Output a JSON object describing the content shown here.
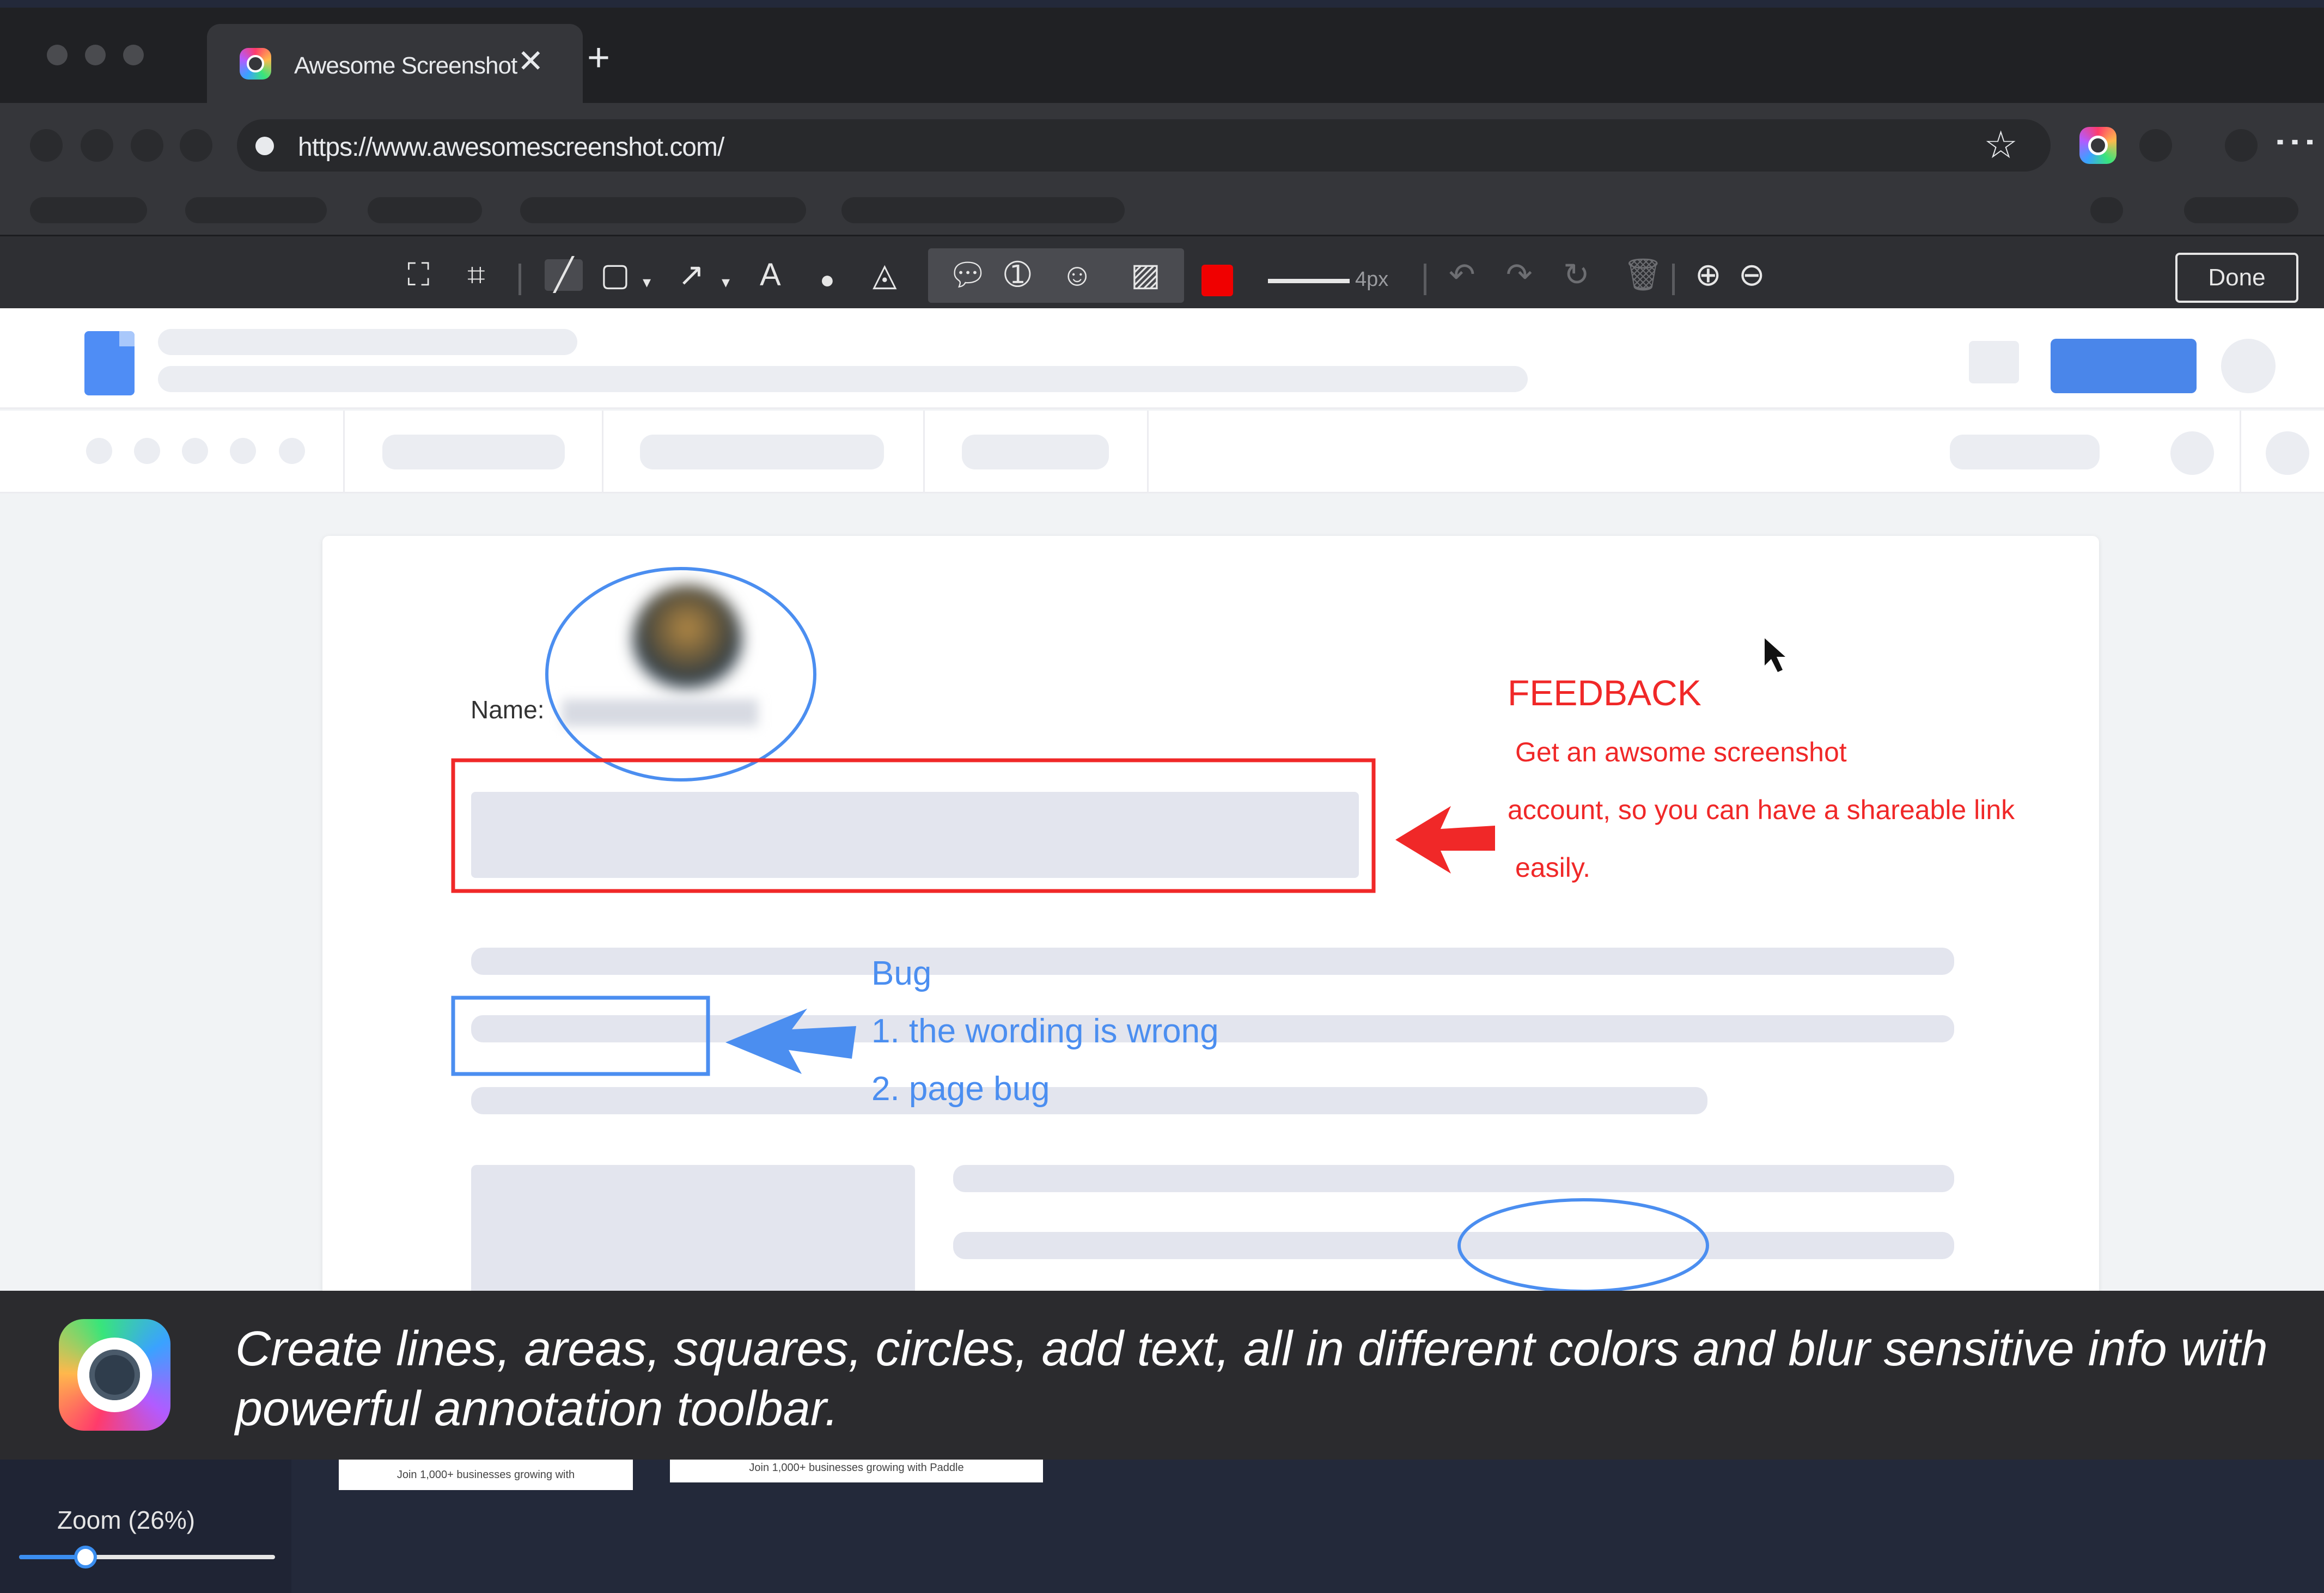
{
  "browser": {
    "tab_title": "Awesome Screenshot",
    "tab_close": "✕",
    "new_tab": "+",
    "url": "https://www.awesomescreenshot.com/",
    "star": "☆",
    "menu": "⋮"
  },
  "toolbar": {
    "tools": [
      {
        "name": "full-page-icon",
        "glyph": "⛶"
      },
      {
        "name": "crop-icon",
        "glyph": "⌗"
      },
      {
        "name": "line-tool-icon",
        "glyph": "╱"
      },
      {
        "name": "rectangle-tool-icon",
        "glyph": "▢"
      },
      {
        "name": "arrow-tool-icon",
        "glyph": "↗"
      },
      {
        "name": "text-tool-icon",
        "glyph": "A"
      },
      {
        "name": "blur-tool-icon",
        "glyph": "●"
      },
      {
        "name": "highlight-tool-icon",
        "glyph": "◬"
      }
    ],
    "stroke_size": "4px",
    "color_hex": "#f00000",
    "done_label": "Done"
  },
  "annotations": {
    "feedback_title": "FEEDBACK",
    "feedback_lines": [
      "Get an awsome screenshot",
      "account, so you can have a shareable link",
      "easily."
    ],
    "bug_title": "Bug",
    "bug_lines": [
      "1. the wording is wrong",
      "2. page bug"
    ],
    "red_color": "#f02828",
    "blue_color": "#4b8ef0"
  },
  "document": {
    "name_label": "Name:"
  },
  "banner": {
    "text": "Create lines, areas, squares, circles, add text, all in different colors and blur sensitive info with powerful annotation toolbar."
  },
  "editor": {
    "zoom_label": "Zoom  (26%)",
    "zoom_percent": 26,
    "thumbnails": [
      "Join 1,000+ businesses growing with",
      "Join 1,000+ businesses growing with Paddle"
    ]
  }
}
